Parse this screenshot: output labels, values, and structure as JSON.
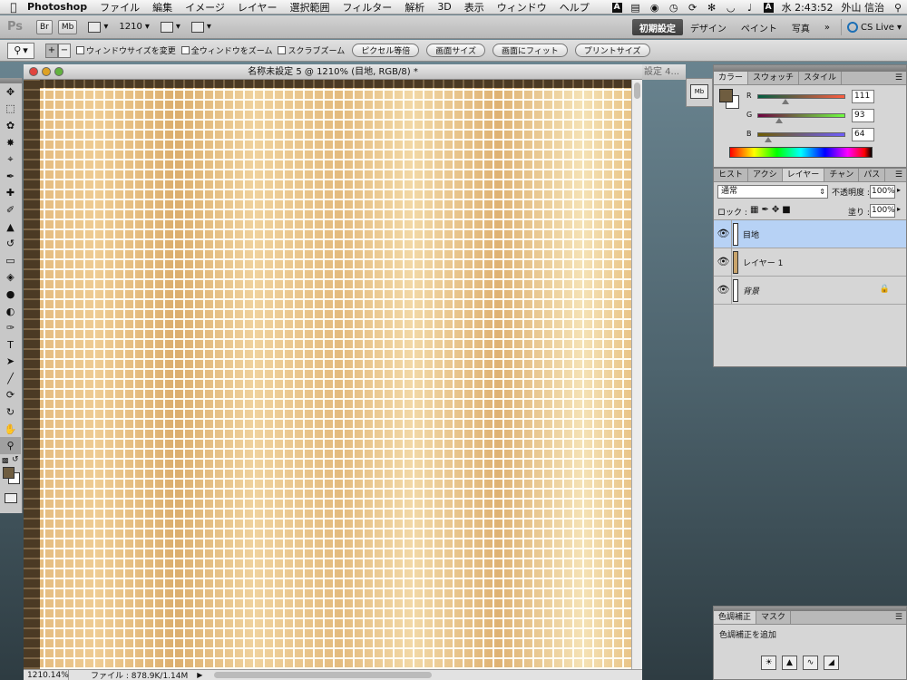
{
  "menubar": {
    "app_name": "Photoshop",
    "menus": [
      "ファイル",
      "編集",
      "イメージ",
      "レイヤー",
      "選択範囲",
      "フィルター",
      "解析",
      "3D",
      "表示",
      "ウィンドウ",
      "ヘルプ"
    ],
    "clock": "水 2:43:52",
    "user": "外山 信治"
  },
  "appbar": {
    "logo": "Ps",
    "bridge_label": "Br",
    "minibridge_label": "Mb",
    "zoom_value": "1210",
    "workspaces": [
      "初期設定",
      "デザイン",
      "ペイント",
      "写真"
    ],
    "more": "»",
    "cs_live": "CS Live"
  },
  "options": {
    "checkbox_resize": "ウィンドウサイズを変更",
    "checkbox_all_windows": "全ウィンドウをズーム",
    "checkbox_scrubby": "スクラブズーム",
    "buttons": [
      "ピクセル等倍",
      "画面サイズ",
      "画面にフィット",
      "プリントサイズ"
    ]
  },
  "document": {
    "title": "名称未設定 5 @ 1210% (目地, RGB/8) *",
    "ghost_tab": "設定 4...",
    "zoom_status": "1210.14%",
    "file_status": "ファイル : 878.9K/1.14M"
  },
  "iconstrip": {
    "mini_bridge": "Mb"
  },
  "color_panel": {
    "tabs": [
      "カラー",
      "スウォッチ",
      "スタイル"
    ],
    "channels": [
      {
        "label": "R",
        "value": "111",
        "level": 0.435
      },
      {
        "label": "G",
        "value": "93",
        "level": 0.365
      },
      {
        "label": "B",
        "value": "64",
        "level": 0.251
      }
    ],
    "foreground": "#6f5d40"
  },
  "layers_panel": {
    "tabs": [
      "ヒスト",
      "アクシ",
      "レイヤー",
      "チャン",
      "パス"
    ],
    "blend_mode": "通常",
    "opacity_label": "不透明度 :",
    "opacity_value": "100%",
    "lock_label": "ロック :",
    "fill_label": "塗り :",
    "fill_value": "100%",
    "layers": [
      {
        "name": "目地"
      },
      {
        "name": "レイヤー 1"
      },
      {
        "name": "背景"
      }
    ]
  },
  "adjustments_panel": {
    "tabs": [
      "色調補正",
      "マスク"
    ],
    "title": "色調補正を追加"
  }
}
